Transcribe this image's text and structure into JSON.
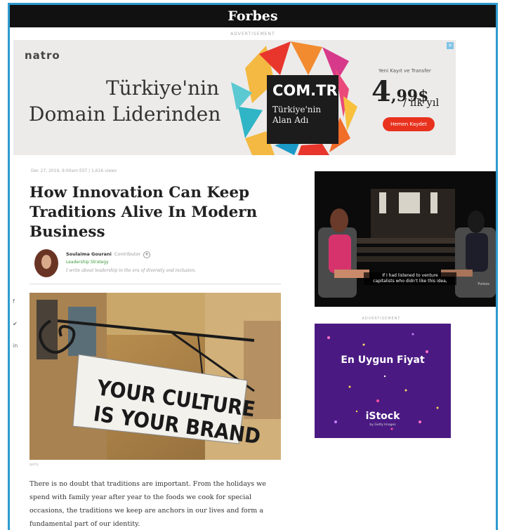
{
  "header": {
    "brand": "Forbes"
  },
  "top_ad": {
    "label": "ADVERTISEMENT",
    "advertiser": "natro",
    "headline_line1": "Türkiye'nin",
    "headline_line2": "Domain Liderinden",
    "badge_title": "COM.TR",
    "badge_sub_line1": "Türkiye'nin",
    "badge_sub_line2": "Alan Adı",
    "price_caption": "Yeni Kayıt ve Transfer",
    "price_main": "4",
    "price_decimals": ",99$",
    "price_period": "/ ilk yıl",
    "cta_label": "Hemen Kaydet",
    "close_label": "✕"
  },
  "article": {
    "meta": "Dec 27, 2019, 9:00am EST  |  1,616 views",
    "title": "How Innovation Can Keep Traditions Alive In Modern Business",
    "author": {
      "name": "Soulaima Gourani",
      "role": "Contributor",
      "follow": "+",
      "category": "Leadership Strategy",
      "bio": "I write about leadership in the era of diversity and inclusion."
    },
    "image": {
      "sign_line1": "YOUR CULTURE",
      "sign_line2": "IS YOUR BRAND",
      "credit": "getty"
    },
    "body": "There is no doubt that traditions are important. From the holidays we spend with family year after year to the foods we cook for special occasions, the traditions we keep are anchors in our lives and form a fundamental part of our identity."
  },
  "social": {
    "facebook": "f",
    "twitter": "✔",
    "linkedin": "in"
  },
  "video": {
    "caption_line1": "If I had listened to venture",
    "caption_line2": "capitalists who didn't like this idea,",
    "brand": "Forbes"
  },
  "side_ad": {
    "label": "ADVERTISEMENT",
    "headline": "En Uygun Fiyat",
    "logo": "iStock",
    "logo_sub": "by Getty Images"
  },
  "colors": {
    "frame": "#2f9bd0",
    "topbar": "#111111",
    "cta": "#e8321e",
    "category": "#3c9a3c",
    "istock_bg": "#4a1a82"
  }
}
